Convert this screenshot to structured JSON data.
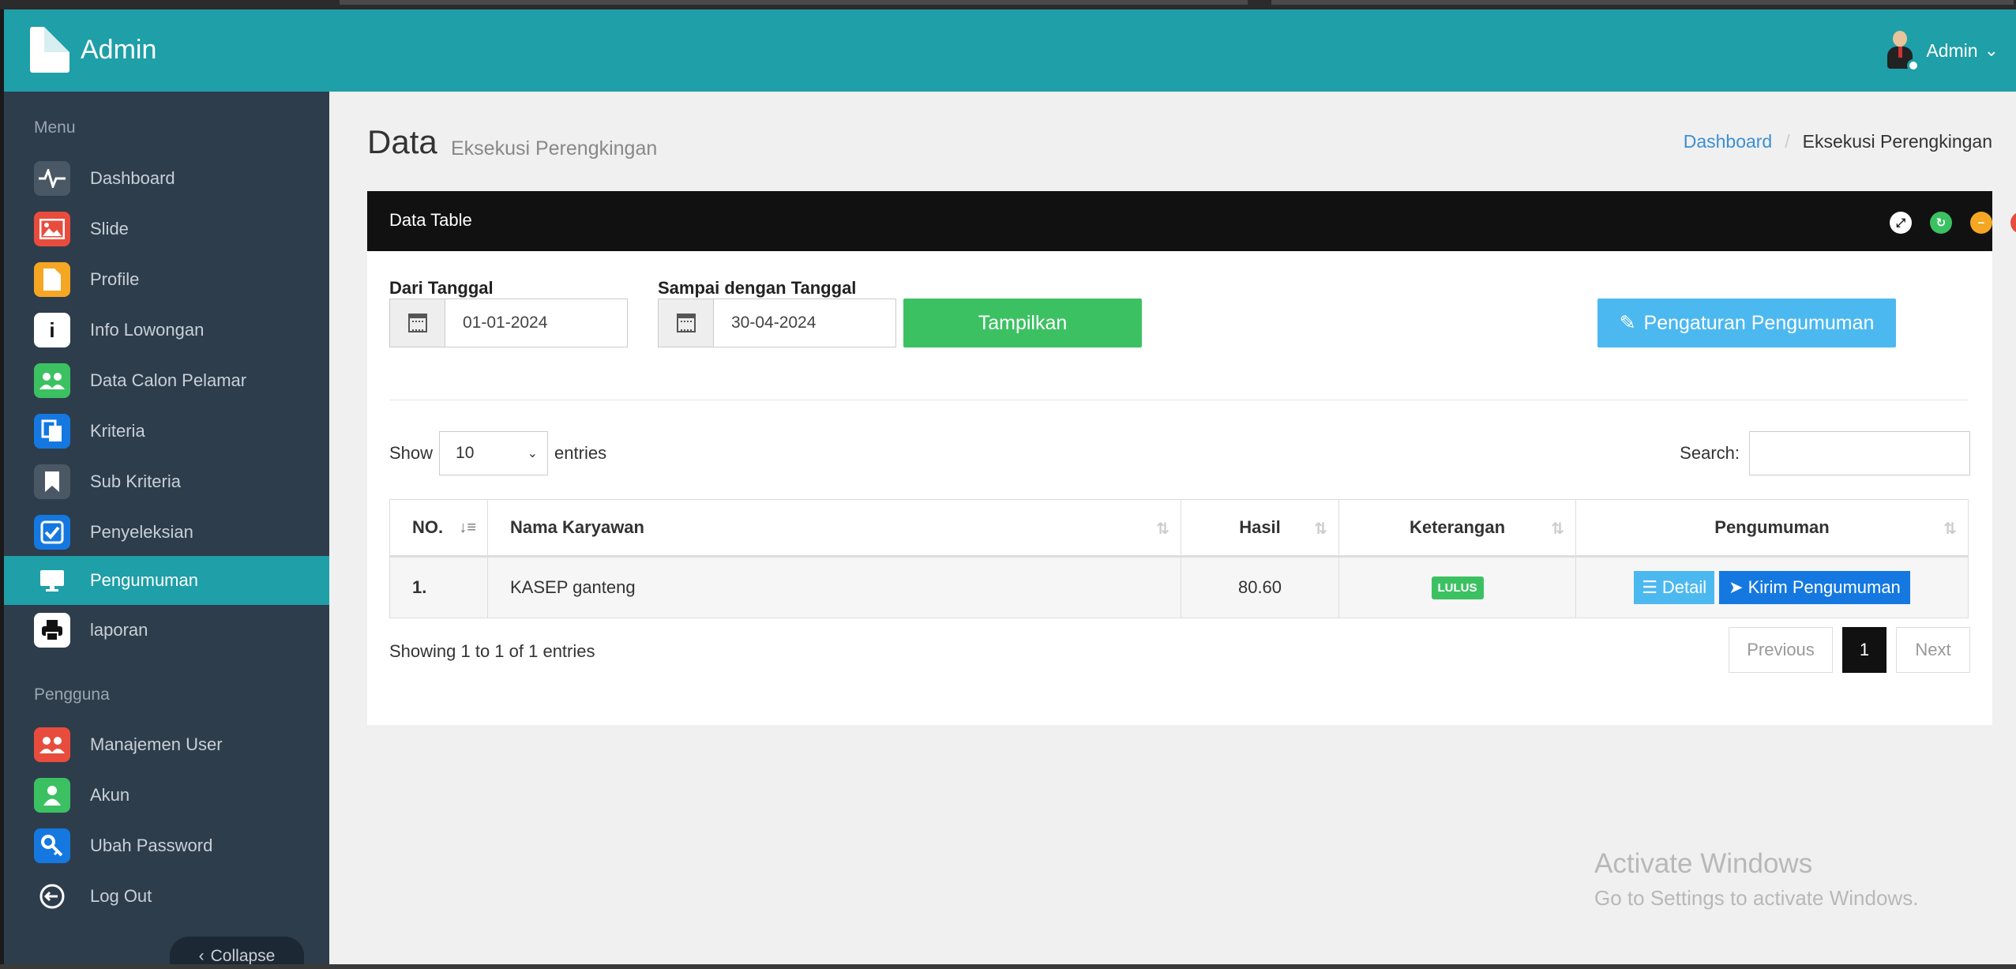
{
  "header": {
    "app_title": "Admin",
    "user_name": "Admin"
  },
  "sidebar": {
    "section_menu": "Menu",
    "menu": [
      {
        "label": "Dashboard",
        "icon": "pulse-icon",
        "color": "#4a5866"
      },
      {
        "label": "Slide",
        "icon": "image-icon",
        "color": "#e84c3d"
      },
      {
        "label": "Profile",
        "icon": "file-icon",
        "color": "#f5a623"
      },
      {
        "label": "Info Lowongan",
        "icon": "info-icon",
        "color": "#111111"
      },
      {
        "label": "Data Calon Pelamar",
        "icon": "users-icon",
        "color": "#3cc162"
      },
      {
        "label": "Kriteria",
        "icon": "copy-icon",
        "color": "#1478e0"
      },
      {
        "label": "Sub Kriteria",
        "icon": "bookmark-icon",
        "color": "#4a5866"
      },
      {
        "label": "Penyeleksian",
        "icon": "check-square-icon",
        "color": "#1478e0"
      },
      {
        "label": "Pengumuman",
        "icon": "desktop-icon",
        "color": "#1f9fa8",
        "active": true
      },
      {
        "label": "laporan",
        "icon": "print-icon",
        "color": "#111111"
      }
    ],
    "section_user": "Pengguna",
    "user_menu": [
      {
        "label": "Manajemen User",
        "icon": "users-icon",
        "color": "#e84c3d"
      },
      {
        "label": "Akun",
        "icon": "user-icon",
        "color": "#3cc162"
      },
      {
        "label": "Ubah Password",
        "icon": "key-icon",
        "color": "#1478e0"
      },
      {
        "label": "Log Out",
        "icon": "logout-icon",
        "color": "#111111"
      }
    ],
    "collapse_label": "Collapse"
  },
  "page": {
    "title": "Data",
    "subtitle": "Eksekusi Perengkingan",
    "breadcrumb": {
      "home": "Dashboard",
      "current": "Eksekusi Perengkingan"
    }
  },
  "panel": {
    "title": "Data Table",
    "filters": {
      "from_label": "Dari Tanggal",
      "from_value": "01-01-2024",
      "to_label": "Sampai dengan Tanggal",
      "to_value": "30-04-2024",
      "show_button": "Tampilkan",
      "settings_button": "Pengaturan Pengumuman"
    },
    "length": {
      "show": "Show",
      "value": "10",
      "entries": "entries"
    },
    "search_label": "Search:",
    "table": {
      "columns": [
        "NO.",
        "Nama Karyawan",
        "Hasil",
        "Keterangan",
        "Pengumuman"
      ],
      "rows": [
        {
          "no": "1.",
          "nama": "KASEP ganteng",
          "hasil": "80.60",
          "keterangan": "LULUS",
          "detail": "Detail",
          "kirim": "Kirim Pengumuman"
        }
      ]
    },
    "info": "Showing 1 to 1 of 1 entries",
    "pager": {
      "previous": "Previous",
      "current": "1",
      "next": "Next"
    }
  },
  "watermark": {
    "line1": "Activate Windows",
    "line2": "Go to Settings to activate Windows."
  }
}
